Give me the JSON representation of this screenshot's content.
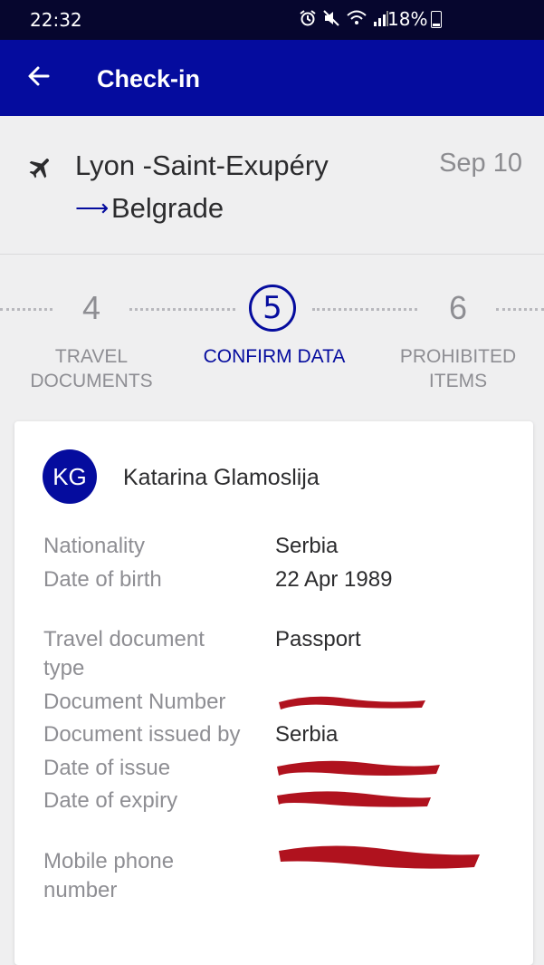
{
  "status_bar": {
    "time": "22:32",
    "battery": "18%"
  },
  "app_bar": {
    "title": "Check-in"
  },
  "route": {
    "from": "Lyon -Saint-Exupéry",
    "arrow": "⟶",
    "to": "Belgrade",
    "date": "Sep 10"
  },
  "steps": [
    {
      "number": "4",
      "label_line1": "TRAVEL",
      "label_line2": "DOCUMENTS"
    },
    {
      "number": "5",
      "label_line1": "CONFIRM DATA",
      "label_line2": ""
    },
    {
      "number": "6",
      "label_line1": "PROHIBITED",
      "label_line2": "ITEMS"
    }
  ],
  "passenger": {
    "initials": "KG",
    "name": "Katarina Glamoslija",
    "fields": {
      "nationality": {
        "label": "Nationality",
        "value": "Serbia"
      },
      "dob": {
        "label": "Date of birth",
        "value": "22 Apr 1989"
      },
      "doc_type": {
        "label_line1": "Travel document",
        "label_line2": "type",
        "value": "Passport"
      },
      "doc_number": {
        "label": "Document Number"
      },
      "issued_by": {
        "label": "Document issued by",
        "value": "Serbia"
      },
      "date_issue": {
        "label": "Date of issue"
      },
      "date_expiry": {
        "label": "Date of expiry"
      },
      "phone": {
        "label_line1": "Mobile phone",
        "label_line2": "number"
      }
    }
  },
  "colors": {
    "brand": "#050c9e",
    "status_bar": "#06062e",
    "redaction": "#b0121e"
  }
}
